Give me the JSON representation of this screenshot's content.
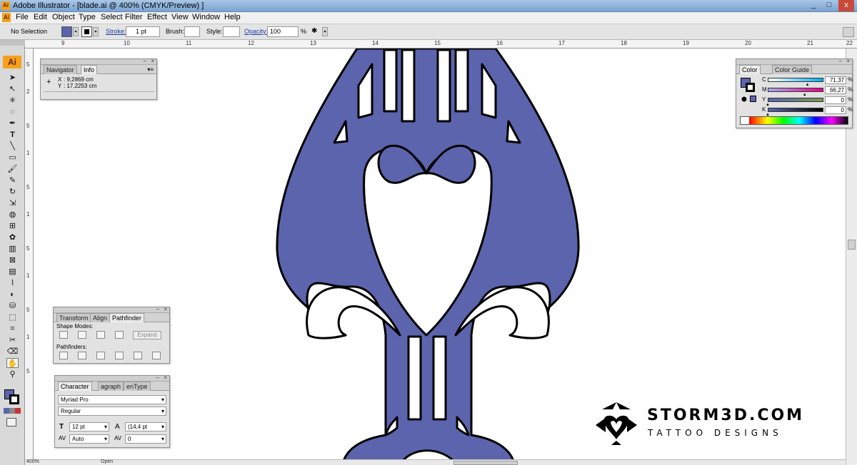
{
  "window": {
    "title": "Adobe Illustrator - [blade.ai @ 400% (CMYK/Preview) ]",
    "logo": "Ai",
    "min": "_",
    "restore": "□",
    "close": "x"
  },
  "menu": {
    "app_icon": "Ai",
    "items": [
      "File",
      "Edit",
      "Object",
      "Type",
      "Select",
      "Filter",
      "Effect",
      "View",
      "Window",
      "Help"
    ]
  },
  "options": {
    "selection": "No Selection",
    "stroke_label": "Stroke:",
    "stroke_value": "1 pt",
    "brush_label": "Brush:",
    "style_label": "Style:",
    "opacity_label": "Opacity:",
    "opacity_value": "100",
    "opacity_unit": "%",
    "fill_color": "#5c64ad"
  },
  "ruler": {
    "top": [
      "9",
      "10",
      "11",
      "12",
      "13",
      "14",
      "15",
      "16",
      "17",
      "18",
      "19",
      "20",
      "21",
      "22"
    ],
    "left": [
      "5",
      "2",
      "5",
      "1",
      "5",
      "1",
      "5",
      "1",
      "5",
      "1",
      "5"
    ]
  },
  "toolbox": {
    "logo": "Ai"
  },
  "info_panel": {
    "tabs": [
      "Navigator",
      "Info"
    ],
    "x_label": "X",
    "x_value": ": 9,2869 cm",
    "y_label": "Y",
    "y_value": ": 17,2253 cm"
  },
  "color_panel": {
    "tabs": [
      "Color",
      "Color Guide"
    ],
    "channels": [
      {
        "name": "C",
        "value": "71,37",
        "fraction": 0.7137
      },
      {
        "name": "M",
        "value": "66,27",
        "fraction": 0.6627
      },
      {
        "name": "Y",
        "value": "0",
        "fraction": 0
      },
      {
        "name": "K",
        "value": "0",
        "fraction": 0
      }
    ],
    "unit": "%",
    "fill_color": "#5c64ad"
  },
  "pathfinder_panel": {
    "tabs": [
      "Transform",
      "Align",
      "Pathfinder"
    ],
    "shape_modes_label": "Shape Modes:",
    "expand_label": "Expand",
    "pathfinders_label": "Pathfinders:"
  },
  "character_panel": {
    "tabs": [
      "Character",
      "agraph",
      "enType"
    ],
    "font_family": "Myriad Pro",
    "font_style": "Regular",
    "font_size": "12 pt",
    "leading": "(14,4 pt",
    "kerning": "Auto",
    "tracking": "0"
  },
  "status": {
    "zoom": "400%",
    "mode": "Open"
  },
  "watermark": {
    "brand": "STORM3D.COM",
    "tagline": "TATTOO DESIGNS"
  },
  "artwork": {
    "fill": "#5c64ad",
    "stroke": "#000000"
  }
}
